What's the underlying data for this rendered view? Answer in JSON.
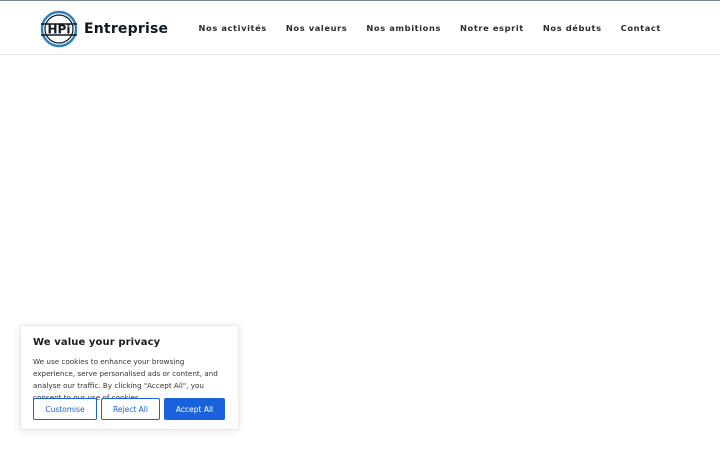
{
  "brand": {
    "logo_letters": "HPi",
    "name": "Entreprise"
  },
  "nav": {
    "items": [
      {
        "label": "Nos activités"
      },
      {
        "label": "Nos valeurs"
      },
      {
        "label": "Nos ambitions"
      },
      {
        "label": "Notre esprit"
      },
      {
        "label": "Nos débuts"
      },
      {
        "label": "Contact"
      }
    ]
  },
  "cookie_banner": {
    "title": "We value your privacy",
    "text": "We use cookies to enhance your browsing experience, serve personalised ads or content, and analyse our traffic. By clicking \"Accept All\", you consent to our use of cookies.",
    "customise_label": "Customise",
    "reject_label": "Reject All",
    "accept_label": "Accept All"
  },
  "colors": {
    "accent": "#1863dc",
    "logo_ring": "#2a7fc1",
    "text_dark": "#101820"
  }
}
